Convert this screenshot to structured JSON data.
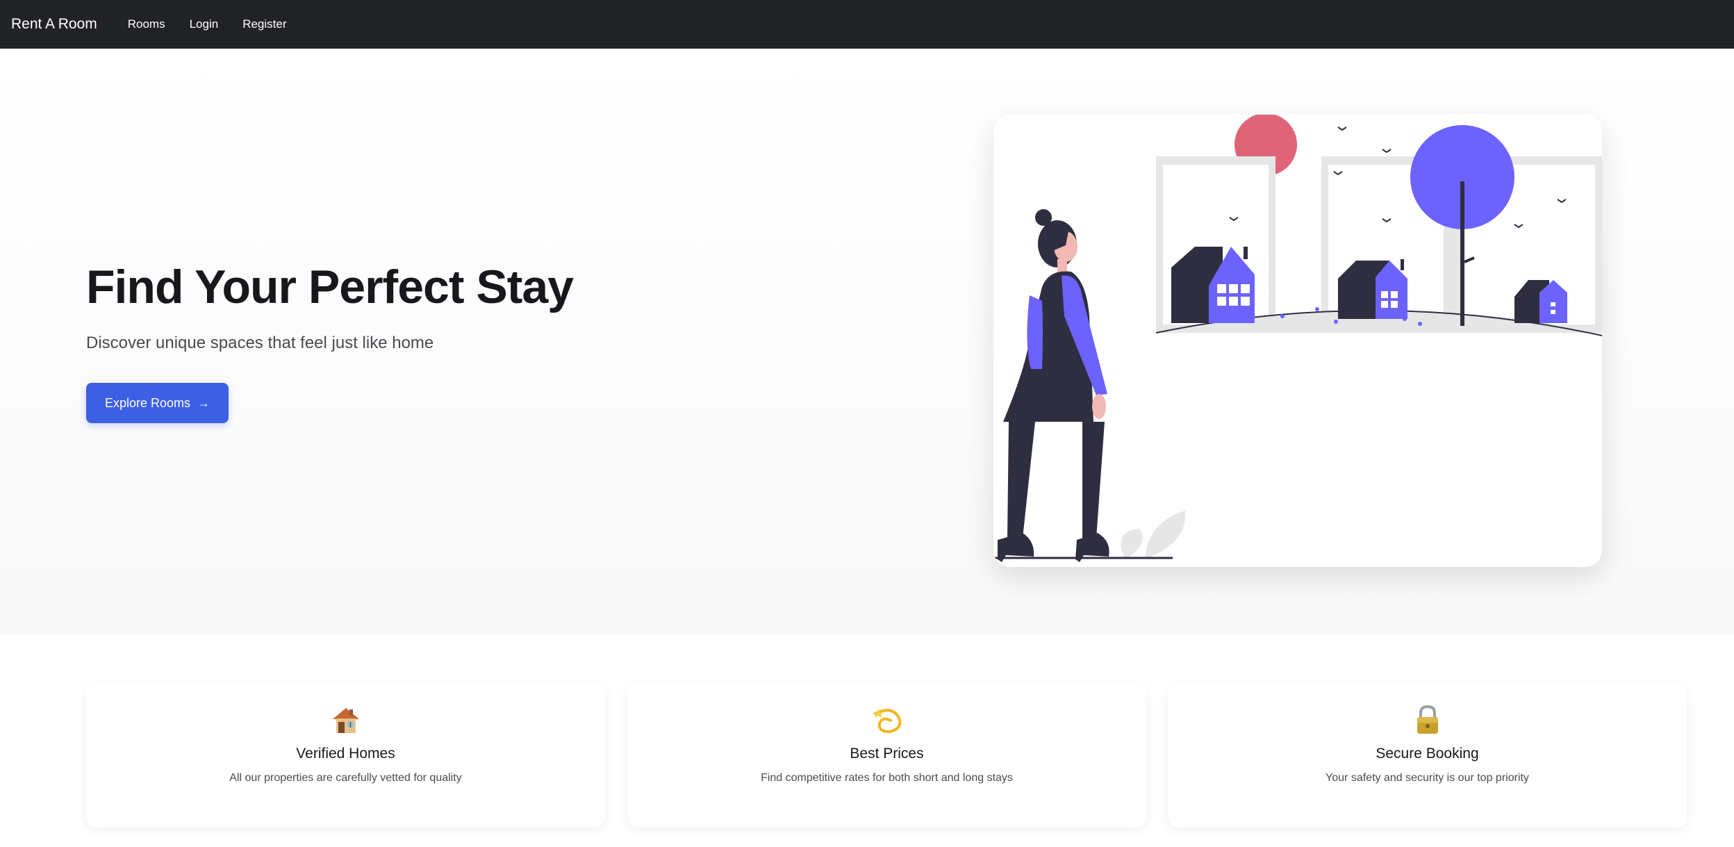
{
  "nav": {
    "brand": "Rent A Room",
    "links": [
      "Rooms",
      "Login",
      "Register"
    ]
  },
  "hero": {
    "title": "Find Your Perfect Stay",
    "subtitle": "Discover unique spaces that feel just like home",
    "cta_label": "Explore Rooms",
    "cta_icon": "arrow-right-icon",
    "illustration": "woman-walking-past-houses-illustration"
  },
  "features": [
    {
      "icon": "house-icon",
      "title": "Verified Homes",
      "description": "All our properties are carefully vetted for quality"
    },
    {
      "icon": "dizzy-icon",
      "title": "Best Prices",
      "description": "Find competitive rates for both short and long stays"
    },
    {
      "icon": "lock-icon",
      "title": "Secure Booking",
      "description": "Your safety and security is our top priority"
    }
  ],
  "colors": {
    "navbar": "#212226",
    "accent": "#3c5fe4",
    "illustration_purple": "#6c63ff",
    "illustration_dark": "#2f2e41",
    "sun": "#e06478"
  }
}
